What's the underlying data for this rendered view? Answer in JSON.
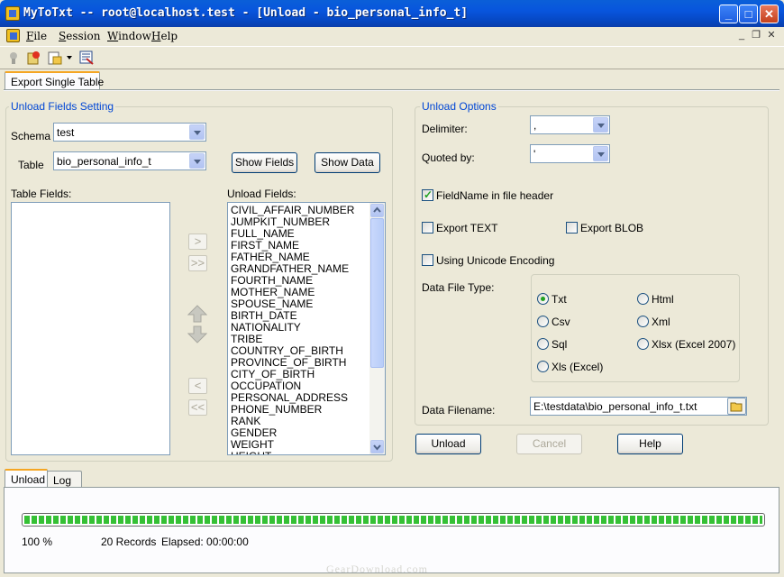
{
  "window": {
    "title": "MyToTxt -- root@localhost.test - [Unload - bio_personal_info_t]",
    "controls": {
      "minimize": "_",
      "maximize": "□",
      "close": "✕"
    }
  },
  "menu": [
    "File",
    "Session",
    "Window",
    "Help"
  ],
  "mdi_controls": {
    "minimize": "_",
    "restore": "❐",
    "close": "✕"
  },
  "toolbar": {
    "icons": [
      "connect-icon",
      "disconnect-icon",
      "open-icon",
      "dropdown-arrow-icon",
      "export-icon"
    ]
  },
  "tabs": {
    "top": [
      "Export Single Table"
    ],
    "bottom": [
      "Unload",
      "Log"
    ]
  },
  "unload_fields_setting": {
    "title": "Unload Fields Setting",
    "schema_label": "Schema",
    "schema_value": "test",
    "table_label": "Table",
    "table_value": "bio_personal_info_t",
    "show_fields": "Show Fields",
    "show_data": "Show Data",
    "table_fields_label": "Table Fields:",
    "unload_fields_label": "Unload Fields:",
    "unload_fields": [
      "CIVIL_AFFAIR_NUMBER",
      "JUMPKIT_NUMBER",
      "FULL_NAME",
      "FIRST_NAME",
      "FATHER_NAME",
      "GRANDFATHER_NAME",
      "FOURTH_NAME",
      "MOTHER_NAME",
      "SPOUSE_NAME",
      "BIRTH_DATE",
      "NATIONALITY",
      "TRIBE",
      "COUNTRY_OF_BIRTH",
      "PROVINCE_OF_BIRTH",
      "CITY_OF_BIRTH",
      "OCCUPATION",
      "PERSONAL_ADDRESS",
      "PHONE_NUMBER",
      "RANK",
      "GENDER",
      "WEIGHT",
      "HEIGHT"
    ],
    "move_buttons": {
      "add": ">",
      "add_all": ">>",
      "remove": "<",
      "remove_all": "<<"
    }
  },
  "unload_options": {
    "title": "Unload Options",
    "delimiter_label": "Delimiter:",
    "delimiter_value": ",",
    "quoted_label": "Quoted by:",
    "quoted_value": "'",
    "fieldname_header": "FieldName in file header",
    "export_text": "Export TEXT",
    "export_blob": "Export BLOB",
    "unicode": "Using Unicode Encoding",
    "data_file_type_label": "Data File Type:",
    "file_types": [
      "Txt",
      "Html",
      "Csv",
      "Xml",
      "Sql",
      "Xlsx (Excel 2007)",
      "Xls (Excel)"
    ],
    "selected_type": "Txt",
    "filename_label": "Data Filename:",
    "filename_value": "E:\\testdata\\bio_personal_info_t.txt"
  },
  "actions": {
    "unload": "Unload",
    "cancel": "Cancel",
    "help": "Help"
  },
  "status": {
    "percent_text": "100 %",
    "progress": 1.0,
    "records": "20 Records",
    "elapsed": "Elapsed: 00:00:00"
  },
  "watermark": "GearDownload.com"
}
